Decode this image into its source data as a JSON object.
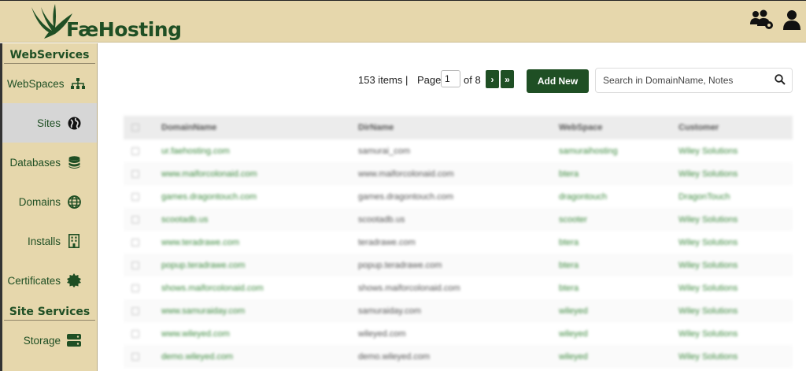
{
  "app": {
    "brand": "FæHosting"
  },
  "colors": {
    "accent": "#1f4f24",
    "sidebar_bg": "#e6d7ac",
    "active_bg": "#d6d6d6",
    "link": "#3d8a3f"
  },
  "header": {
    "icons": [
      "users-gear-icon",
      "user-icon"
    ]
  },
  "sidebar": {
    "sections": [
      {
        "title": "WebServices",
        "items": [
          {
            "label": "WebSpaces",
            "icon": "sitemap-icon"
          },
          {
            "label": "Sites",
            "icon": "globe-icon",
            "active": true
          },
          {
            "label": "Databases",
            "icon": "database-icon"
          },
          {
            "label": "Domains",
            "icon": "globe-grid-icon"
          },
          {
            "label": "Installs",
            "icon": "building-icon"
          },
          {
            "label": "Certificates",
            "icon": "certificate-icon"
          }
        ]
      },
      {
        "title": "Site Services",
        "items": [
          {
            "label": "Storage",
            "icon": "server-icon"
          }
        ]
      }
    ]
  },
  "toolbar": {
    "items_count": "153 items |",
    "page_label": "Page",
    "page_value": "1",
    "of_label": "of 8",
    "next": "›",
    "last": "»",
    "add_new": "Add New",
    "search_placeholder": "Search in DomainName, Notes"
  },
  "table": {
    "columns": [
      "DomainName",
      "DirName",
      "WebSpace",
      "Customer"
    ],
    "rows": [
      [
        "ur.faehosting.com",
        "samurai_com",
        "samuraihosting",
        "Wiley Solutions"
      ],
      [
        "www.maiforcolonaid.com",
        "www.maiforcolonaid.com",
        "btera",
        "Wiley Solutions"
      ],
      [
        "games.dragontouch.com",
        "games.dragontouch.com",
        "dragontouch",
        "DragonTouch"
      ],
      [
        "scootadb.us",
        "scootadb.us",
        "scooter",
        "Wiley Solutions"
      ],
      [
        "www.teradrawe.com",
        "teradrawe.com",
        "btera",
        "Wiley Solutions"
      ],
      [
        "popup.teradrawe.com",
        "popup.teradrawe.com",
        "btera",
        "Wiley Solutions"
      ],
      [
        "shows.maiforcolonaid.com",
        "shows.maiforcolonaid.com",
        "btera",
        "Wiley Solutions"
      ],
      [
        "www.samuraiday.com",
        "samuraiday.com",
        "wileyed",
        "Wiley Solutions"
      ],
      [
        "www.wileyed.com",
        "wileyed.com",
        "wileyed",
        "Wiley Solutions"
      ],
      [
        "demo.wileyed.com",
        "demo.wileyed.com",
        "wileyed",
        "Wiley Solutions"
      ]
    ]
  }
}
